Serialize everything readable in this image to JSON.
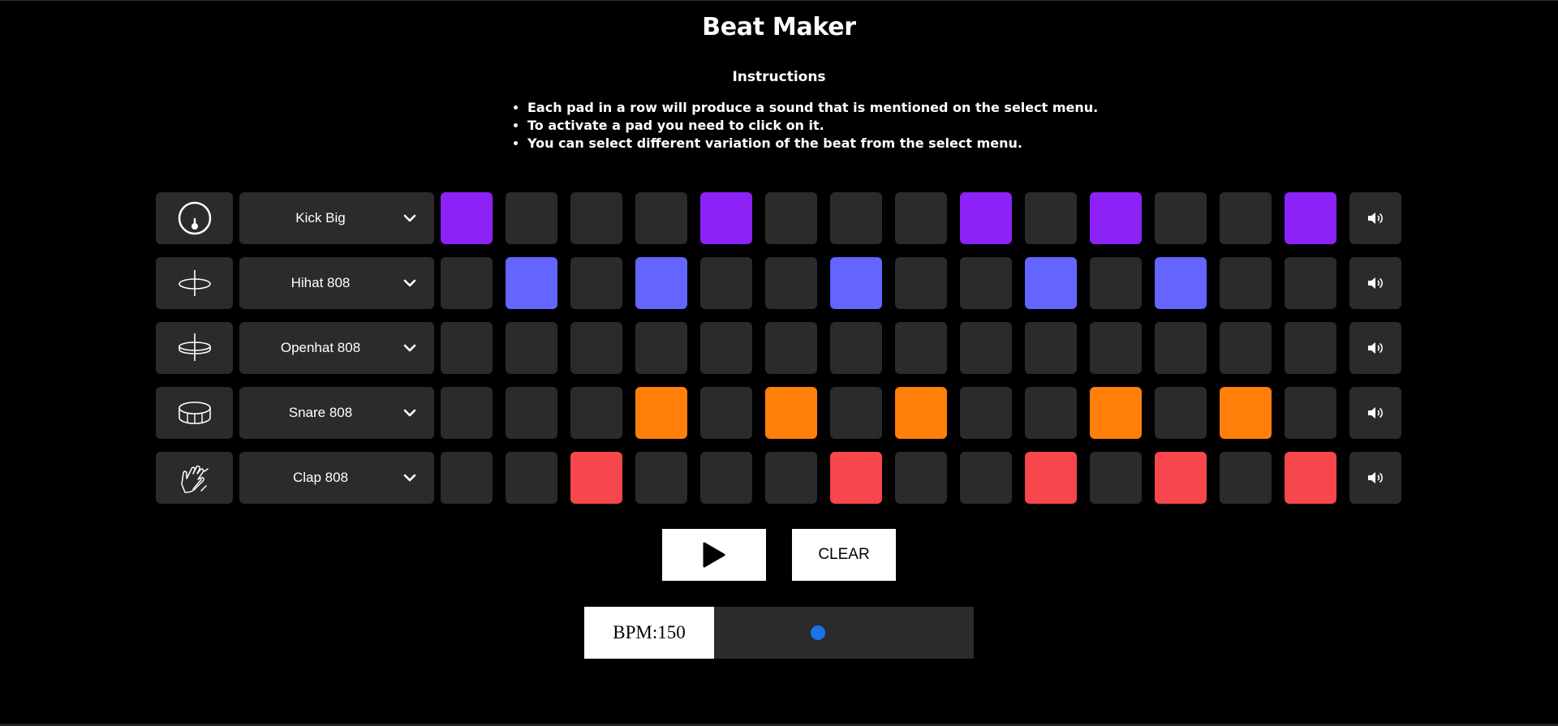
{
  "title": "Beat Maker",
  "instructions": {
    "heading": "Instructions",
    "items": [
      "Each pad in a row will produce a sound that is mentioned on the select menu.",
      "To activate a pad you need to click on it.",
      "You can select different variation of the beat from the select menu."
    ]
  },
  "colors": {
    "background": "#000000",
    "cell": "#2b2b2b",
    "kick": "#8c22f5",
    "hihat": "#6464ff",
    "snare": "#ff7f0a",
    "clap": "#f5474c",
    "slider_thumb": "#1a73e8"
  },
  "tracks": [
    {
      "icon": "kick-drum-icon",
      "sound": "Kick Big",
      "color": "#8c22f5",
      "pads": [
        1,
        0,
        0,
        0,
        1,
        0,
        0,
        0,
        1,
        0,
        1,
        0,
        0,
        1
      ],
      "mute_icon": "speaker-icon"
    },
    {
      "icon": "hihat-icon",
      "sound": "Hihat 808",
      "color": "#6464ff",
      "pads": [
        0,
        1,
        0,
        1,
        0,
        0,
        1,
        0,
        0,
        1,
        0,
        1,
        0,
        0
      ],
      "mute_icon": "speaker-icon"
    },
    {
      "icon": "openhat-icon",
      "sound": "Openhat 808",
      "color": "#ffd400",
      "pads": [
        0,
        0,
        0,
        0,
        0,
        0,
        0,
        0,
        0,
        0,
        0,
        0,
        0,
        0
      ],
      "mute_icon": "speaker-icon"
    },
    {
      "icon": "snare-drum-icon",
      "sound": "Snare 808",
      "color": "#ff7f0a",
      "pads": [
        0,
        0,
        0,
        1,
        0,
        1,
        0,
        1,
        0,
        0,
        1,
        0,
        1,
        0
      ],
      "mute_icon": "speaker-icon"
    },
    {
      "icon": "clap-icon",
      "sound": "Clap 808",
      "color": "#f5474c",
      "pads": [
        0,
        0,
        1,
        0,
        0,
        0,
        1,
        0,
        0,
        1,
        0,
        1,
        0,
        1
      ],
      "mute_icon": "speaker-icon"
    }
  ],
  "controls": {
    "play_icon": "play-icon",
    "clear_label": "CLEAR",
    "bpm_label": "BPM:150",
    "bpm_value": 150,
    "bpm_fraction": 0.34
  }
}
